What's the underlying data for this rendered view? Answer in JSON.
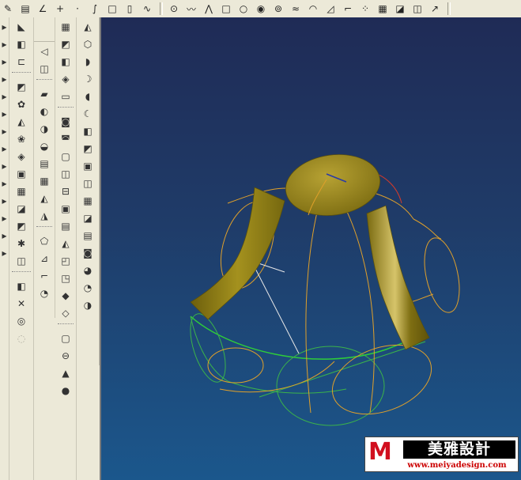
{
  "watermark": {
    "title": "美雅設計",
    "url": "www.meiyadesign.com"
  },
  "colors": {
    "viewport_top": "#1f2b56",
    "viewport_bottom": "#1b578c",
    "surface_gold": "#8b7a14",
    "curve_orange": "#e0a02a",
    "curve_green": "#2ecc3a",
    "toolbar_bg": "#ece9d8",
    "logo_red": "#d10f1f"
  },
  "toolbar_icons": [
    "pencil-icon",
    "notepad-icon",
    "angle-icon",
    "plus-icon",
    "dot-icon",
    "spline-icon",
    "square-icon",
    "page-icon",
    "curve-icon",
    "point-icon",
    "polyline-icon",
    "node-icon",
    "rectangle-icon",
    "circle-icon",
    "circle-dot-icon",
    "helix-icon",
    "wave-icon",
    "fillet-icon",
    "chamfer-icon",
    "corner-icon",
    "scatter-icon",
    "grid-icon",
    "cube-icon",
    "cubes-icon",
    "arrow-icon"
  ],
  "columns": [
    {
      "id": "col1",
      "icons": [
        "tool-a",
        "tool-b",
        "tool-c",
        "tool-d",
        "tool-e",
        "tool-f",
        "tool-g",
        "tool-h",
        "tool-i",
        "tool-j",
        "tool-k",
        "tool-l",
        "tool-m",
        "tool-n"
      ]
    },
    {
      "id": "col2",
      "icons": [
        "surface-a",
        "surface-b",
        "surface-c",
        "surface-d",
        "surface-e",
        "surface-f",
        "surface-g",
        "surface-h",
        "surface-i",
        "surface-j",
        "surface-k",
        "surface-l",
        "surface-m",
        "surface-n",
        "surface-o",
        "surface-p",
        "surface-q",
        "surface-r"
      ]
    },
    {
      "id": "col3",
      "icons": [
        "sweep-a",
        "sweep-b",
        "sweep-c",
        "sweep-d",
        "sweep-e",
        "sweep-f",
        "sweep-g",
        "sweep-h",
        "sweep-i",
        "sweep-j",
        "sweep-k",
        "sweep-l",
        "sweep-m",
        "sweep-n",
        "sweep-o"
      ]
    },
    {
      "id": "col4",
      "icons": [
        "edit-a",
        "edit-b",
        "edit-c",
        "edit-d",
        "edit-e",
        "edit-f",
        "edit-g",
        "edit-h",
        "edit-i",
        "edit-j",
        "edit-k",
        "edit-l",
        "edit-m",
        "edit-n",
        "edit-o",
        "edit-p",
        "edit-q",
        "edit-r",
        "box-icon",
        "cylinder-icon",
        "cone-icon",
        "sphere-icon"
      ]
    },
    {
      "id": "col5",
      "icons": [
        "solid-a",
        "solid-b",
        "solid-c",
        "solid-d",
        "solid-e",
        "solid-f",
        "solid-g",
        "solid-h",
        "solid-i",
        "solid-j",
        "solid-k",
        "solid-l",
        "solid-m",
        "solid-n",
        "solid-o",
        "solid-p",
        "solid-q"
      ]
    }
  ]
}
